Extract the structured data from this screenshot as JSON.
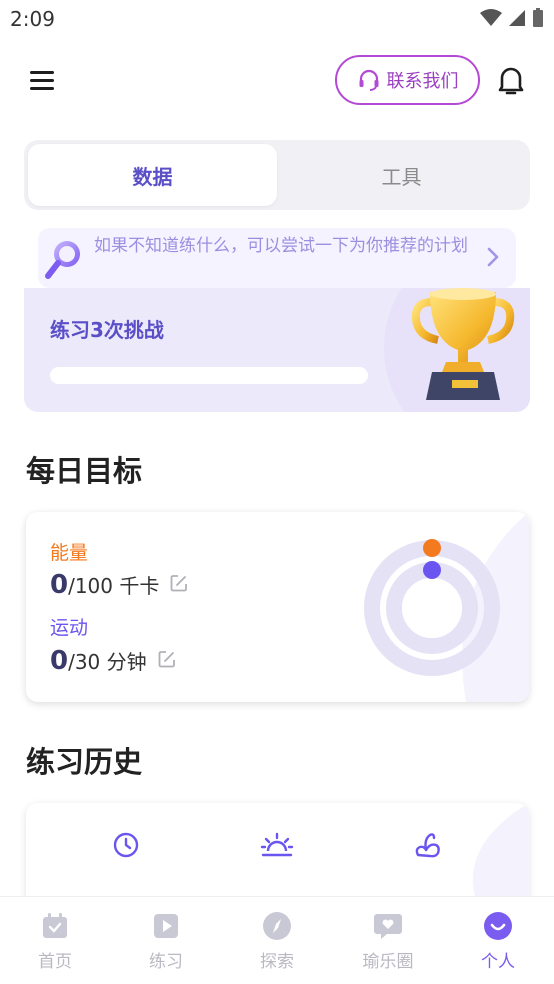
{
  "status_bar": {
    "time": "2:09"
  },
  "header": {
    "contact_label": "联系我们"
  },
  "tabs": [
    {
      "label": "数据",
      "active": true
    },
    {
      "label": "工具",
      "active": false
    }
  ],
  "tip": {
    "text": "如果不知道练什么，可以尝试一下为你推荐的计划"
  },
  "challenge": {
    "title": "练习3次挑战",
    "progress": 0
  },
  "daily_goal": {
    "title": "每日目标",
    "energy": {
      "label": "能量",
      "current": "0",
      "target": "/100 千卡"
    },
    "exercise": {
      "label": "运动",
      "current": "0",
      "target": "/30 分钟"
    },
    "colors": {
      "energy": "#f47a20",
      "exercise": "#6a55f0",
      "ring": "#e6e2f5"
    }
  },
  "history": {
    "title": "练习历史",
    "icons": [
      "clock-icon",
      "sunrise-icon",
      "muscle-icon"
    ]
  },
  "bottom_nav": [
    {
      "label": "首页",
      "icon": "calendar-icon",
      "active": false
    },
    {
      "label": "练习",
      "icon": "play-icon",
      "active": false
    },
    {
      "label": "探索",
      "icon": "compass-icon",
      "active": false
    },
    {
      "label": "瑜乐圈",
      "icon": "chat-heart-icon",
      "active": false
    },
    {
      "label": "个人",
      "icon": "smile-icon",
      "active": true
    }
  ]
}
